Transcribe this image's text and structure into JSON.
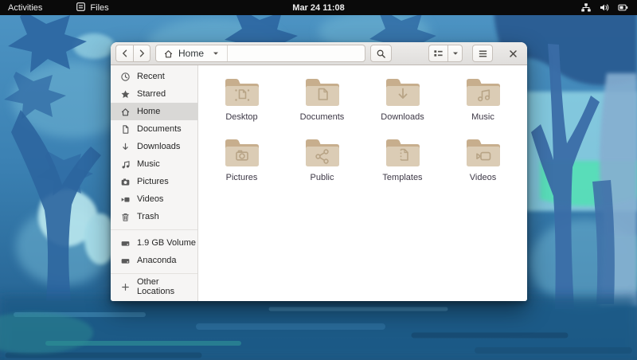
{
  "topbar": {
    "activities_label": "Activities",
    "app_name": "Files",
    "clock": "Mar 24 11:08",
    "status_icons": [
      "network-wired-icon",
      "volume-icon",
      "battery-icon"
    ]
  },
  "headerbar": {
    "location_label": "Home",
    "icons": [
      "back-icon",
      "forward-icon",
      "home-icon",
      "chevron-down-icon",
      "search-icon",
      "view-list-icon",
      "view-dropdown-icon",
      "hamburger-menu-icon",
      "close-icon"
    ]
  },
  "sidebar": {
    "items": [
      {
        "label": "Recent",
        "icon": "recent-clock-icon",
        "selected": false
      },
      {
        "label": "Starred",
        "icon": "star-icon",
        "selected": false
      },
      {
        "label": "Home",
        "icon": "home-icon",
        "selected": true
      },
      {
        "label": "Documents",
        "icon": "document-icon",
        "selected": false
      },
      {
        "label": "Downloads",
        "icon": "download-arrow-icon",
        "selected": false
      },
      {
        "label": "Music",
        "icon": "music-note-icon",
        "selected": false
      },
      {
        "label": "Pictures",
        "icon": "camera-icon",
        "selected": false
      },
      {
        "label": "Videos",
        "icon": "video-camera-icon",
        "selected": false
      },
      {
        "label": "Trash",
        "icon": "trash-icon",
        "selected": false
      }
    ],
    "devices": [
      {
        "label": "1.9 GB Volume",
        "icon": "hard-drive-icon"
      },
      {
        "label": "Anaconda",
        "icon": "hard-drive-icon"
      }
    ],
    "other_locations_label": "Other Locations"
  },
  "files": [
    {
      "name": "Desktop",
      "emblem": "desktop-emblem-icon"
    },
    {
      "name": "Documents",
      "emblem": "document-emblem-icon"
    },
    {
      "name": "Downloads",
      "emblem": "download-emblem-icon"
    },
    {
      "name": "Music",
      "emblem": "music-emblem-icon"
    },
    {
      "name": "Pictures",
      "emblem": "camera-emblem-icon"
    },
    {
      "name": "Public",
      "emblem": "share-emblem-icon"
    },
    {
      "name": "Templates",
      "emblem": "template-emblem-icon"
    },
    {
      "name": "Videos",
      "emblem": "video-emblem-icon"
    }
  ],
  "colors": {
    "topbar_bg": "#0a0a0a",
    "headerbar_bg": "#e9e7e5",
    "sidebar_bg": "#f6f5f4",
    "sidebar_selected_bg": "#d9d8d6",
    "content_bg": "#ffffff",
    "folder_back": "#c7ae8d",
    "folder_front": "#dbccb5",
    "folder_emblem": "#b8a486",
    "wallpaper_blue": "#3b81b3",
    "wallpaper_mint": "#54dfb5"
  }
}
